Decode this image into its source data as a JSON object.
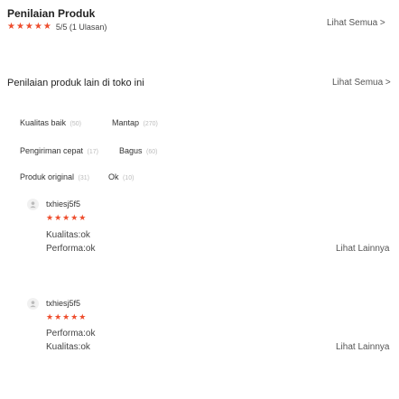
{
  "header": {
    "title": "Penilaian Produk",
    "stars": "★★★★★",
    "rating_summary": "5/5 (1 Ulasan)",
    "see_all": "Lihat Semua >"
  },
  "shop_section": {
    "title": "Penilaian produk lain di toko ini",
    "see_all": "Lihat Semua >"
  },
  "tags": [
    {
      "label": "Kualitas baik",
      "count": "(50)"
    },
    {
      "label": "Mantap",
      "count": "(270)"
    },
    {
      "label": "Pengiriman cepat",
      "count": "(17)"
    },
    {
      "label": "Bagus",
      "count": "(60)"
    },
    {
      "label": "Produk original",
      "count": "(31)"
    },
    {
      "label": "Ok",
      "count": "(10)"
    }
  ],
  "reviews": [
    {
      "user": "txhiesj5f5",
      "stars": "★★★★★",
      "lines": [
        "Kualitas:ok",
        "Performa:ok"
      ],
      "more": "Lihat Lainnya"
    },
    {
      "user": "txhiesj5f5",
      "stars": "★★★★★",
      "lines": [
        "Performa:ok",
        "Kualitas:ok"
      ],
      "more": "Lihat Lainnya"
    }
  ]
}
